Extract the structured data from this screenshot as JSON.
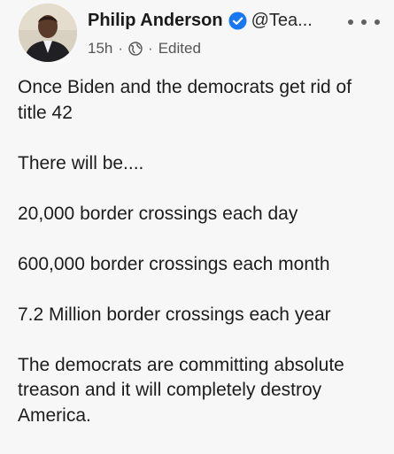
{
  "post": {
    "author": {
      "name": "Philip Anderson",
      "handle": "@Tea...",
      "verified": true
    },
    "meta": {
      "time": "15h",
      "separator": "·",
      "audience_icon": "globe-icon",
      "edited_label": "Edited"
    },
    "more_icon": "more-options-icon",
    "paragraphs": [
      "Once Biden and the democrats get rid of title 42",
      "There will be....",
      "20,000 border crossings each day",
      "600,000 border crossings each month",
      "7.2 Million border crossings each year",
      "The democrats are committing absolute treason and it will completely destroy America."
    ]
  },
  "colors": {
    "background": "#f7f7f7",
    "text": "#1c1c1c",
    "verified_badge": "#1877f2",
    "meta_text": "#555555"
  }
}
